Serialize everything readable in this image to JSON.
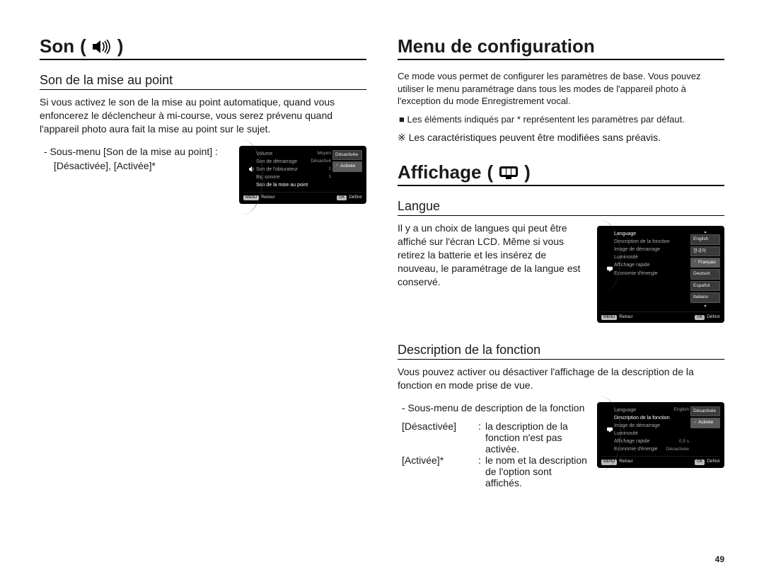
{
  "pageNumber": "49",
  "left": {
    "title": "Son",
    "section1": {
      "heading": "Son de la mise au point",
      "paragraph": "Si vous activez le son de la mise au point automatique, quand vous enfoncerez le déclencheur à mi-course, vous serez prévenu quand l'appareil photo aura fait la mise au point sur le sujet.",
      "submenuLine1": "- Sous-menu [Son de la mise au point] :",
      "submenuLine2": "[Désactivée], [Activée]*"
    },
    "lcd1": {
      "rows": [
        {
          "label": "Volume",
          "value": "Moyen"
        },
        {
          "label": "Son de démarrage",
          "value": "Désactivé"
        },
        {
          "label": "Son de l'obturateur",
          "value": "1"
        },
        {
          "label": "Bip sonore",
          "value": "1"
        },
        {
          "label": "Son de la mise au point",
          "value": ""
        }
      ],
      "selectedIndex": 4,
      "popup": [
        "Désactivée",
        "Activée"
      ],
      "popupSelectedIndex": 1,
      "footerLeftBtn": "MENU",
      "footerLeft": "Retour",
      "footerRightBtn": "OK",
      "footerRight": "Définir"
    }
  },
  "right": {
    "title1": "Menu de configuration",
    "intro": "Ce mode vous permet de configurer les paramètres de base. Vous pouvez utiliser le menu paramétrage dans tous les modes de l'appareil photo à l'exception du mode Enregistrement vocal.",
    "bullet": "Les éléments indiqués par * représentent les paramètres par défaut.",
    "refSymbol": "※",
    "note": "Les caractéristiques peuvent être modifiées sans préavis.",
    "title2": "Affichage",
    "sectionLangue": {
      "heading": "Langue",
      "paragraph": "Il y a un choix de langues qui peut être affiché sur l'écran LCD. Même si vous retirez la batterie et les insérez de nouveau, le paramétrage de la langue est conservé."
    },
    "lcd2": {
      "rows": [
        {
          "label": "Language",
          "value": ""
        },
        {
          "label": "Description de la fonction",
          "value": ""
        },
        {
          "label": "Image de démarrage",
          "value": ""
        },
        {
          "label": "Luminosité",
          "value": ""
        },
        {
          "label": "Affichage rapide",
          "value": ""
        },
        {
          "label": "Economie d'énergie",
          "value": ""
        }
      ],
      "selectedIndex": 0,
      "popup": [
        "English",
        "한국어",
        "Français",
        "Deutsch",
        "Español",
        "Italiano"
      ],
      "popupSelectedIndex": 2,
      "footerLeftBtn": "MENU",
      "footerLeft": "Retour",
      "footerRightBtn": "OK",
      "footerRight": "Définir"
    },
    "sectionDesc": {
      "heading": "Description de la fonction",
      "paragraph": "Vous pouvez activer ou désactiver l'affichage de la description de la fonction en mode prise de vue.",
      "submenuLine": "- Sous-menu de description de la fonction",
      "options": [
        {
          "key": "[Désactivée]",
          "value": "la description de la fonction n'est pas activée."
        },
        {
          "key": "[Activée]*",
          "value": "le nom et la description de l'option sont affichés."
        }
      ]
    },
    "lcd3": {
      "rows": [
        {
          "label": "Language",
          "value": "English"
        },
        {
          "label": "Description de la fonction",
          "value": ""
        },
        {
          "label": "Image de démarrage",
          "value": ""
        },
        {
          "label": "Luminosité",
          "value": ""
        },
        {
          "label": "Affichage rapide",
          "value": "0,5 s"
        },
        {
          "label": "Economie d'énergie",
          "value": "Désactivée"
        }
      ],
      "selectedIndex": 1,
      "popup": [
        "Désactivée",
        "Activée"
      ],
      "popupSelectedIndex": 1,
      "footerLeftBtn": "MENU",
      "footerLeft": "Retour",
      "footerRightBtn": "OK",
      "footerRight": "Définir"
    }
  }
}
